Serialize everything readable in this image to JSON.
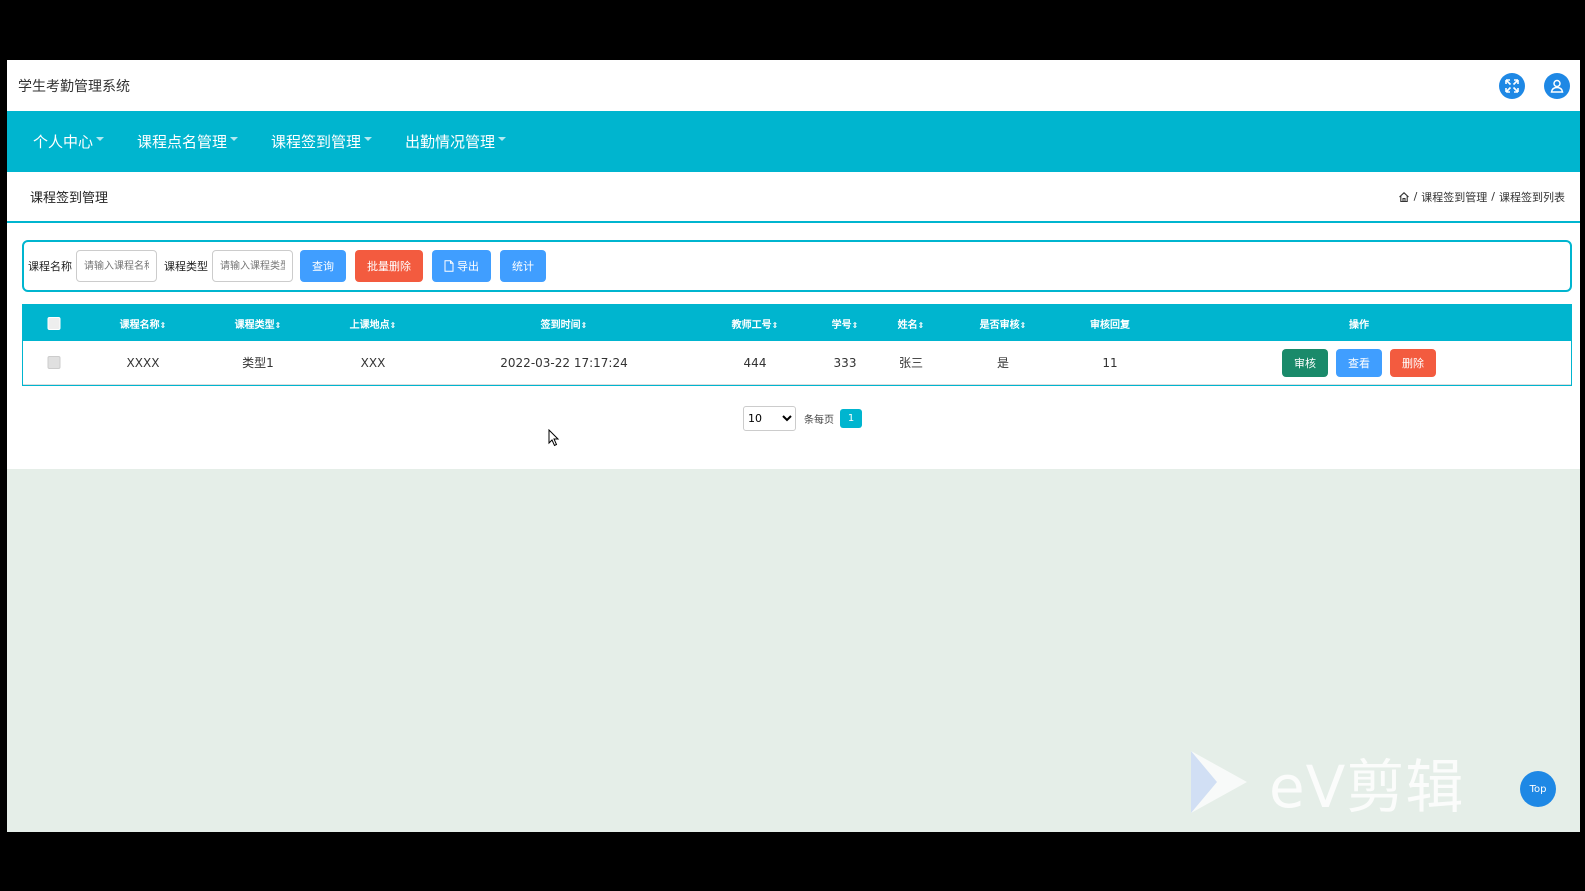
{
  "app": {
    "title": "学生考勤管理系统"
  },
  "nav": {
    "items": [
      {
        "label": "个人中心"
      },
      {
        "label": "课程点名管理"
      },
      {
        "label": "课程签到管理"
      },
      {
        "label": "出勤情况管理"
      }
    ]
  },
  "page": {
    "title": "课程签到管理",
    "breadcrumb": [
      "课程签到管理",
      "课程签到列表"
    ],
    "breadcrumb_sep": "/"
  },
  "search": {
    "course_name_label": "课程名称",
    "course_name_placeholder": "请输入课程名称",
    "course_type_label": "课程类型",
    "course_type_placeholder": "请输入课程类型",
    "query_button": "查询",
    "batch_delete_button": "批量删除",
    "export_button": "导出",
    "stats_button": "统计"
  },
  "table": {
    "columns": [
      {
        "label": "课程名称",
        "sortable": true
      },
      {
        "label": "课程类型",
        "sortable": true
      },
      {
        "label": "上课地点",
        "sortable": true
      },
      {
        "label": "签到时间",
        "sortable": true
      },
      {
        "label": "教师工号",
        "sortable": true
      },
      {
        "label": "学号",
        "sortable": true
      },
      {
        "label": "姓名",
        "sortable": true
      },
      {
        "label": "是否审核",
        "sortable": true
      },
      {
        "label": "审核回复",
        "sortable": false
      },
      {
        "label": "操作",
        "sortable": false
      }
    ],
    "sort_mark": "⇕",
    "rows": [
      {
        "course_name": "XXXX",
        "course_type": "类型1",
        "location": "XXX",
        "checkin_time": "2022-03-22 17:17:24",
        "teacher_id": "444",
        "student_id": "333",
        "name": "张三",
        "reviewed": "是",
        "review_reply": "11",
        "actions": {
          "review": "审核",
          "view": "查看",
          "delete": "删除"
        }
      }
    ]
  },
  "pagination": {
    "page_size": "10",
    "page_size_options": [
      "10"
    ],
    "per_page_label": "条每页",
    "current_page": "1"
  },
  "back_to_top": "Top",
  "watermark": "eV剪辑",
  "colors": {
    "primary": "#00b5cf",
    "button_blue": "#409eff",
    "button_red": "#f35b3f",
    "button_teal": "#1a8a6a",
    "icon_blue": "#1e88e5",
    "background": "#e5eee8"
  }
}
